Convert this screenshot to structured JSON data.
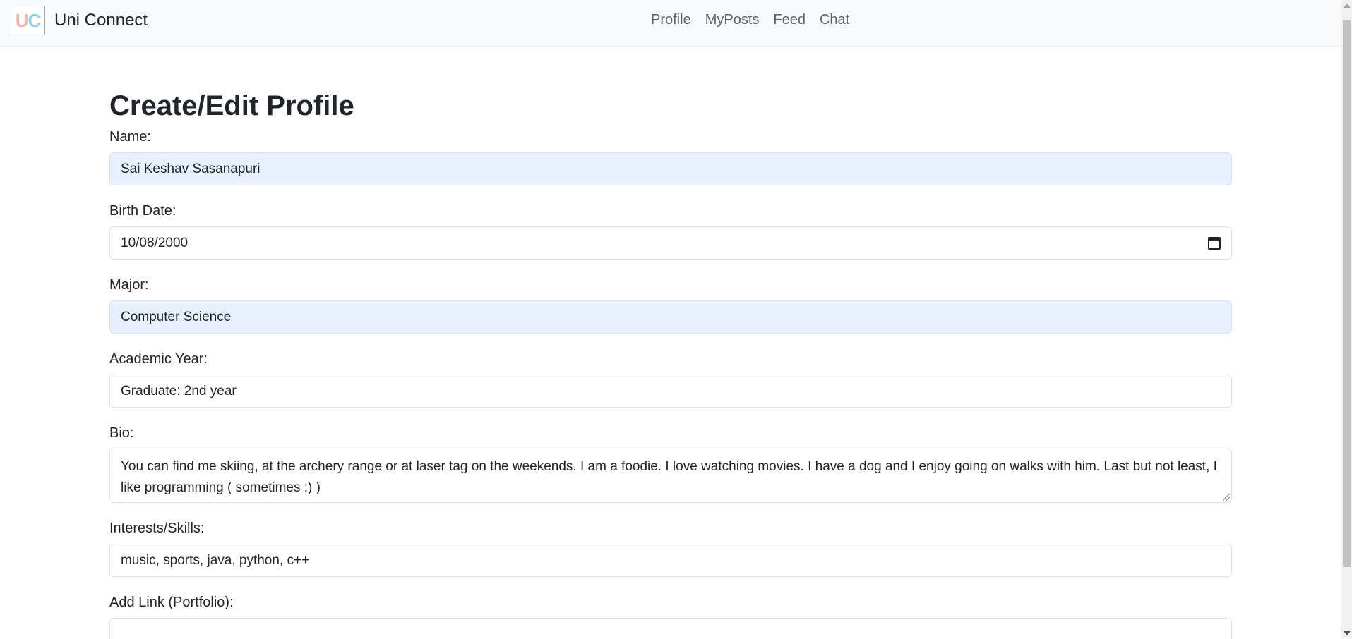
{
  "brand": {
    "logo_letters": {
      "u": "U",
      "c": "C"
    },
    "name": "Uni Connect"
  },
  "nav": {
    "items": [
      "Profile",
      "MyPosts",
      "Feed",
      "Chat"
    ]
  },
  "page": {
    "title": "Create/Edit Profile"
  },
  "form": {
    "name": {
      "label": "Name:",
      "value": "Sai Keshav Sasanapuri"
    },
    "birth_date": {
      "label": "Birth Date:",
      "value": "10/08/2000"
    },
    "major": {
      "label": "Major:",
      "value": "Computer Science"
    },
    "academic_year": {
      "label": "Academic Year:",
      "value": "Graduate: 2nd year"
    },
    "bio": {
      "label": "Bio:",
      "value": "You can find me skiing, at the archery range or at laser tag on the weekends. I am a foodie. I love watching movies. I have a dog and I enjoy going on walks with him. Last but not least, I like programming ( sometimes :) )"
    },
    "interests": {
      "label": "Interests/Skills:",
      "value": "music, sports, java, python, c++"
    },
    "link": {
      "label": "Add Link (Portfolio):",
      "value": ""
    }
  },
  "icons": {
    "date_picker": "calendar-icon"
  },
  "colors": {
    "navbar_bg": "#f8f9fa",
    "autofill_bg": "#e8f0fe",
    "logo_u": "#f2b7a2",
    "logo_c": "#8fd0ea"
  }
}
